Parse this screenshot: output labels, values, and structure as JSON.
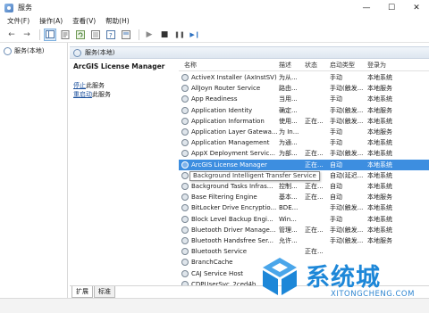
{
  "window": {
    "title": "服务",
    "minimize": "—",
    "maximize": "☐",
    "close": "✕"
  },
  "menu": [
    "文件(F)",
    "操作(A)",
    "查看(V)",
    "帮助(H)"
  ],
  "toolbar": {
    "back": "←",
    "forward": "→",
    "play": "▶",
    "stop": "■",
    "pause": "❚❚",
    "restart": "▶❙"
  },
  "tree": {
    "root_label": "服务(本地)"
  },
  "band": {
    "label": "服务(本地)"
  },
  "detail": {
    "title": "ArcGIS License Manager",
    "stop_link": "停止",
    "stop_suffix": "此服务",
    "restart_link": "重启动",
    "restart_suffix": "此服务"
  },
  "columns": {
    "name": "名称",
    "description": "描述",
    "status": "状态",
    "startup": "启动类型",
    "logon": "登录为"
  },
  "rows": [
    {
      "name": "ActiveX Installer (AxInstSV)",
      "desc": "为从...",
      "status": "",
      "startup": "手动",
      "logon": "本地系统"
    },
    {
      "name": "AllJoyn Router Service",
      "desc": "路由...",
      "status": "",
      "startup": "手动(触发...",
      "logon": "本地服务"
    },
    {
      "name": "App Readiness",
      "desc": "当用...",
      "status": "",
      "startup": "手动",
      "logon": "本地系统"
    },
    {
      "name": "Application Identity",
      "desc": "确定...",
      "status": "",
      "startup": "手动(触发...",
      "logon": "本地服务"
    },
    {
      "name": "Application Information",
      "desc": "使用...",
      "status": "正在...",
      "startup": "手动(触发...",
      "logon": "本地系统"
    },
    {
      "name": "Application Layer Gatewa...",
      "desc": "为 In...",
      "status": "",
      "startup": "手动",
      "logon": "本地服务"
    },
    {
      "name": "Application Management",
      "desc": "为通...",
      "status": "",
      "startup": "手动",
      "logon": "本地系统"
    },
    {
      "name": "AppX Deployment Servic...",
      "desc": "为部...",
      "status": "正在...",
      "startup": "手动(触发...",
      "logon": "本地系统"
    },
    {
      "name": "ArcGIS License Manager",
      "desc": "",
      "status": "正在...",
      "startup": "自动",
      "logon": "本地系统",
      "selected": true
    },
    {
      "name": "Background Intelligent T...",
      "desc": "使用...",
      "status": "",
      "startup": "自动(延迟...",
      "logon": "本地系统"
    },
    {
      "name": "Background Tasks Infras...",
      "desc": "控制...",
      "status": "正在...",
      "startup": "自动",
      "logon": "本地系统"
    },
    {
      "name": "Base Filtering Engine",
      "desc": "基本...",
      "status": "正在...",
      "startup": "自动",
      "logon": "本地服务"
    },
    {
      "name": "BitLocker Drive Encryptio...",
      "desc": "BDE...",
      "status": "",
      "startup": "手动(触发...",
      "logon": "本地系统"
    },
    {
      "name": "Block Level Backup Engi...",
      "desc": "Win...",
      "status": "",
      "startup": "手动",
      "logon": "本地系统"
    },
    {
      "name": "Bluetooth Driver Manage...",
      "desc": "管理...",
      "status": "正在...",
      "startup": "手动(触发...",
      "logon": "本地系统"
    },
    {
      "name": "Bluetooth Handsfree Ser...",
      "desc": "允许...",
      "status": "",
      "startup": "手动(触发...",
      "logon": "本地服务"
    },
    {
      "name": "Bluetooth Service",
      "desc": "",
      "status": "正在...",
      "startup": "",
      "logon": ""
    },
    {
      "name": "BranchCache",
      "desc": "",
      "status": "",
      "startup": "",
      "logon": ""
    },
    {
      "name": "CAJ Service Host",
      "desc": "",
      "status": "",
      "startup": "",
      "logon": ""
    },
    {
      "name": "CDPUserSvc_2ced4b",
      "desc": "",
      "status": "",
      "startup": "",
      "logon": ""
    }
  ],
  "tooltip": "Background Intelligent Transfer Service",
  "tabs": [
    "扩展",
    "标准"
  ],
  "watermark": {
    "brand": "系统城",
    "url": "XITONGCHENG.COM",
    "colors": {
      "blue": "#1d87d8",
      "light": "#4aa6ea"
    }
  },
  "colors": {
    "selection": "#3d8ee0",
    "link": "#1a4f9c"
  }
}
